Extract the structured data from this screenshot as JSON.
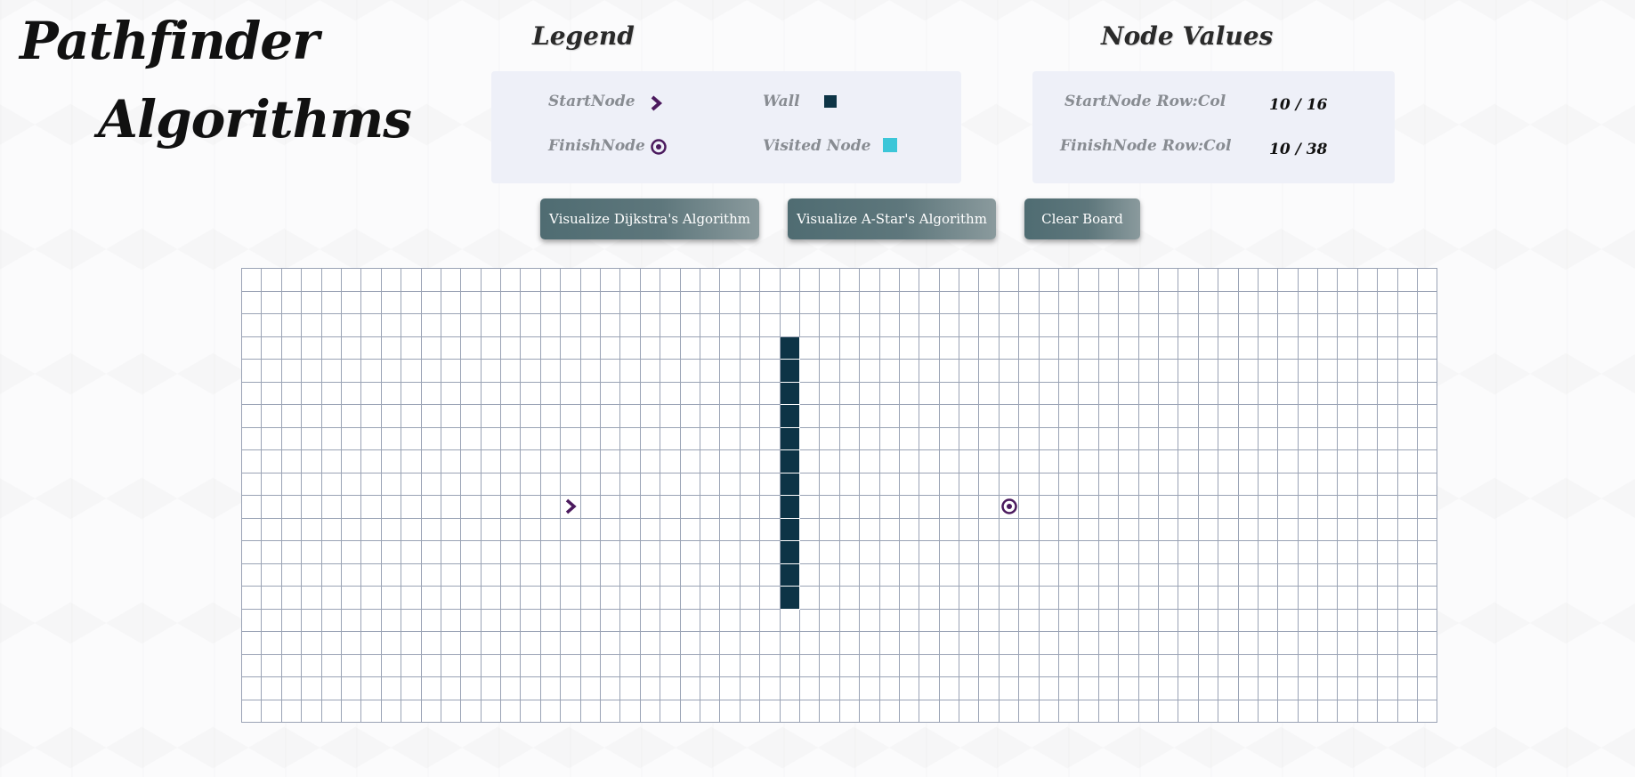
{
  "header": {
    "title_line1": "Pathfinder",
    "title_line2": "Algorithms"
  },
  "legend": {
    "heading": "Legend",
    "start_node_label": "StartNode",
    "finish_node_label": "FinishNode",
    "wall_label": "Wall",
    "visited_node_label": "Visited Node"
  },
  "node_values": {
    "heading": "Node Values",
    "start_label": "StartNode Row:Col",
    "start_value": "10 / 16",
    "finish_label": "FinishNode Row:Col",
    "finish_value": "10 / 38"
  },
  "buttons": {
    "dijkstra": "Visualize Dijkstra's Algorithm",
    "astar": "Visualize A-Star's Algorithm",
    "clear": "Clear Board"
  },
  "grid": {
    "rows": 20,
    "cols": 60,
    "start": {
      "row": 10,
      "col": 16
    },
    "finish": {
      "row": 10,
      "col": 38
    },
    "walls": [
      {
        "row": 3,
        "col": 27
      },
      {
        "row": 4,
        "col": 27
      },
      {
        "row": 5,
        "col": 27
      },
      {
        "row": 6,
        "col": 27
      },
      {
        "row": 7,
        "col": 27
      },
      {
        "row": 8,
        "col": 27
      },
      {
        "row": 9,
        "col": 27
      },
      {
        "row": 10,
        "col": 27
      },
      {
        "row": 11,
        "col": 27
      },
      {
        "row": 12,
        "col": 27
      },
      {
        "row": 13,
        "col": 27
      },
      {
        "row": 14,
        "col": 27
      }
    ]
  },
  "colors": {
    "wall": "#0d3446",
    "visited": "#3cc6d8",
    "node_marker": "#4b1a5e",
    "button": "#5e777c",
    "panel": "#eef0f8"
  },
  "icons": {
    "start": "chevron-right-icon",
    "finish": "target-icon",
    "wall": "wall-square-icon",
    "visited": "visited-square-icon"
  }
}
